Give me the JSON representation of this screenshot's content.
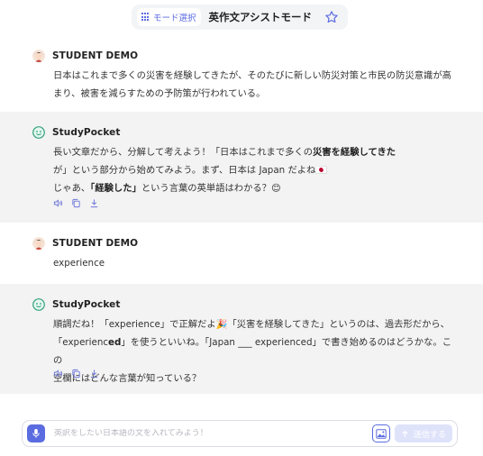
{
  "header": {
    "mode_button_label": "モード選択",
    "title": "英作文アシストモード"
  },
  "messages": [
    {
      "sender": "STUDENT DEMO",
      "lines": [
        "日本はこれまで多くの災害を経験してきたが、そのたびに新しい防災対策と市民の防災意識が高",
        "まり、被害を減らすための予防策が行われている。"
      ]
    },
    {
      "sender": "StudyPocket",
      "line1_pre": "長い文章だから、分解して考えよう！「日本はこれまで多くの",
      "line1_bold": "災害を経験してきた",
      "line2": "が」という部分から始めてみよう。まず、日本は Japan だよね🇯🇵",
      "line3_pre": "じゃあ、",
      "line3_bold": "「経験した」",
      "line3_post": "という言葉の英単語はわかる？😊"
    },
    {
      "sender": "STUDENT DEMO",
      "text": "experience"
    },
    {
      "sender": "StudyPocket",
      "line1": "順調だね！「experience」で正解だよ🎉「災害を経験してきた」というのは、過去形だから、",
      "line2_pre": "「experienc",
      "line2_bold": "ed",
      "line2_post": "」を使うといいね。「Japan ___ experienced」で書き始めるのはどうかな。この",
      "line3": "空欄にはどんな言葉が知っている？"
    }
  ],
  "input": {
    "placeholder": "英訳をしたい日本語の文を入れてみよう！",
    "send_label": "送信する"
  },
  "colors": {
    "accent": "#5b6be0",
    "bot_bg": "#f3f3f4",
    "send_disabled": "#dfe3fa"
  }
}
